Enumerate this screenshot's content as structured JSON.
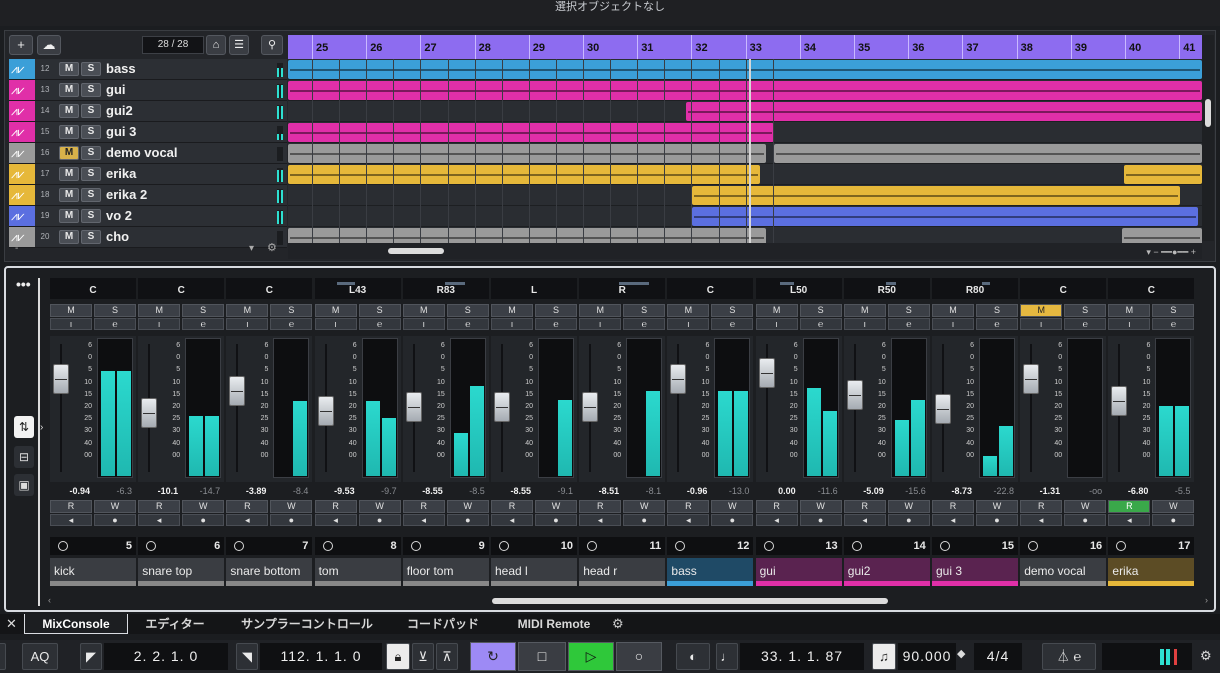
{
  "window": {
    "title": "選択オブジェクトなし"
  },
  "project": {
    "counter": "28 / 28",
    "ruler": [
      "25",
      "26",
      "27",
      "28",
      "29",
      "30",
      "31",
      "32",
      "33",
      "34",
      "35",
      "36",
      "37",
      "38",
      "39",
      "40",
      "41"
    ],
    "tracks": [
      {
        "num": "12",
        "name": "bass",
        "color": "#3b9fd8",
        "m": false
      },
      {
        "num": "13",
        "name": "gui",
        "color": "#e02fa8",
        "m": false
      },
      {
        "num": "14",
        "name": "gui2",
        "color": "#e02fa8",
        "m": false
      },
      {
        "num": "15",
        "name": "gui 3",
        "color": "#e02fa8",
        "m": false
      },
      {
        "num": "16",
        "name": "demo vocal",
        "color": "#9a9a9a",
        "m": true
      },
      {
        "num": "17",
        "name": "erika",
        "color": "#e6b83a",
        "m": false
      },
      {
        "num": "18",
        "name": "erika 2",
        "color": "#e6b83a",
        "m": false
      },
      {
        "num": "19",
        "name": "vo 2",
        "color": "#5b6fe0",
        "m": false
      },
      {
        "num": "20",
        "name": "cho",
        "color": "#9a9a9a",
        "m": false
      }
    ]
  },
  "mixer": {
    "channels": [
      {
        "pan": "C",
        "fader": "-0.94",
        "peak": "-6.3",
        "num": "5",
        "name": "kick",
        "color": "#888",
        "m": false,
        "r": false
      },
      {
        "pan": "C",
        "fader": "-10.1",
        "peak": "-14.7",
        "num": "6",
        "name": "snare top",
        "color": "#888",
        "m": false,
        "r": false
      },
      {
        "pan": "C",
        "fader": "-3.89",
        "peak": "-8.4",
        "num": "7",
        "name": "snare bottom",
        "color": "#888",
        "m": false,
        "r": false
      },
      {
        "pan": "L43",
        "fader": "-9.53",
        "peak": "-9.7",
        "num": "8",
        "name": "tom",
        "color": "#888",
        "m": false,
        "r": false
      },
      {
        "pan": "R83",
        "fader": "-8.55",
        "peak": "-8.5",
        "num": "9",
        "name": "floor tom",
        "color": "#888",
        "m": false,
        "r": false
      },
      {
        "pan": "L",
        "fader": "-8.55",
        "peak": "-9.1",
        "num": "10",
        "name": "head l",
        "color": "#888",
        "m": false,
        "r": false
      },
      {
        "pan": "R",
        "fader": "-8.51",
        "peak": "-8.1",
        "num": "11",
        "name": "head r",
        "color": "#888",
        "m": false,
        "r": false
      },
      {
        "pan": "C",
        "fader": "-0.96",
        "peak": "-13.0",
        "num": "12",
        "name": "bass",
        "color": "#3b9fd8",
        "m": false,
        "r": false
      },
      {
        "pan": "L50",
        "fader": "0.00",
        "peak": "-11.6",
        "num": "13",
        "name": "gui",
        "color": "#e02fa8",
        "m": false,
        "r": false
      },
      {
        "pan": "R50",
        "fader": "-5.09",
        "peak": "-15.6",
        "num": "14",
        "name": "gui2",
        "color": "#e02fa8",
        "m": false,
        "r": false
      },
      {
        "pan": "R80",
        "fader": "-8.73",
        "peak": "-22.8",
        "num": "15",
        "name": "gui 3",
        "color": "#e02fa8",
        "m": false,
        "r": false
      },
      {
        "pan": "C",
        "fader": "-1.31",
        "peak": "-oo",
        "num": "16",
        "name": "demo vocal",
        "color": "#888",
        "m": true,
        "r": false
      },
      {
        "pan": "C",
        "fader": "-6.80",
        "peak": "-5.5",
        "num": "17",
        "name": "erika",
        "color": "#e6b83a",
        "m": false,
        "r": true
      }
    ],
    "scale": [
      "6",
      "0",
      "5",
      "10",
      "15",
      "20",
      "25",
      "30",
      "40",
      "00"
    ]
  },
  "tabs": [
    "MixConsole",
    "エディター",
    "サンプラーコントロール",
    "コードパッド",
    "MIDI Remote"
  ],
  "transport": {
    "aq": "AQ",
    "left_locator": "2. 2. 1.   0",
    "right_locator": "112. 1. 1.   0",
    "position": "33. 1. 1.  87",
    "tempo": "90.000",
    "signature": "4/4"
  },
  "labels": {
    "m": "M",
    "s": "S",
    "r": "R",
    "w": "W"
  }
}
